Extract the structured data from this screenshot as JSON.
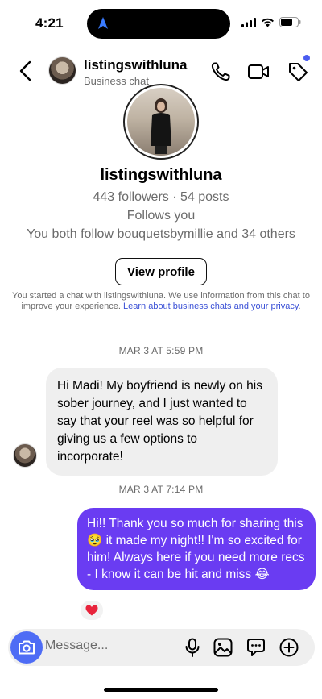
{
  "status_bar": {
    "time": "4:21",
    "icons": [
      "navigation-arrow-icon",
      "signal-icon",
      "wifi-icon",
      "battery-icon"
    ]
  },
  "header": {
    "title": "listingswithluna",
    "subtitle": "Business chat",
    "icons": [
      "back-chevron-icon",
      "phone-icon",
      "video-camera-icon",
      "tag-icon"
    ]
  },
  "profile": {
    "name": "listingswithluna",
    "stats": "443 followers · 54 posts",
    "follows": "Follows you",
    "mutual": "You both follow bouquetsbymillie and 34 others",
    "view_button": "View profile"
  },
  "disclaimer": {
    "text": "You started a chat with listingswithluna. We use information from this chat to improve your experience.",
    "link": "Learn about business chats and your privacy",
    "end": "."
  },
  "messages": [
    {
      "timestamp": "MAR 3 AT 5:59 PM",
      "direction": "incoming",
      "text": "Hi Madi! My boyfriend is newly on his sober journey, and I just wanted to say that your reel was so helpful for giving us a few options to incorporate!"
    },
    {
      "timestamp": "MAR 3 AT 7:14 PM",
      "direction": "outgoing",
      "text": "Hi!! Thank you so much for sharing this 🥹 it made my night!! I'm so excited for him! Always here if you need more recs - I know it can be hit and miss 😂",
      "reaction": "❤️"
    }
  ],
  "composer": {
    "placeholder": "Message...",
    "icons": [
      "camera-icon",
      "microphone-icon",
      "gallery-icon",
      "sticker-icon",
      "plus-icon"
    ]
  },
  "colors": {
    "outgoing_bubble": "#6a3cf2",
    "incoming_bubble": "#efefef",
    "camera_button": "#4e6cf5",
    "link": "#3b51d6"
  }
}
